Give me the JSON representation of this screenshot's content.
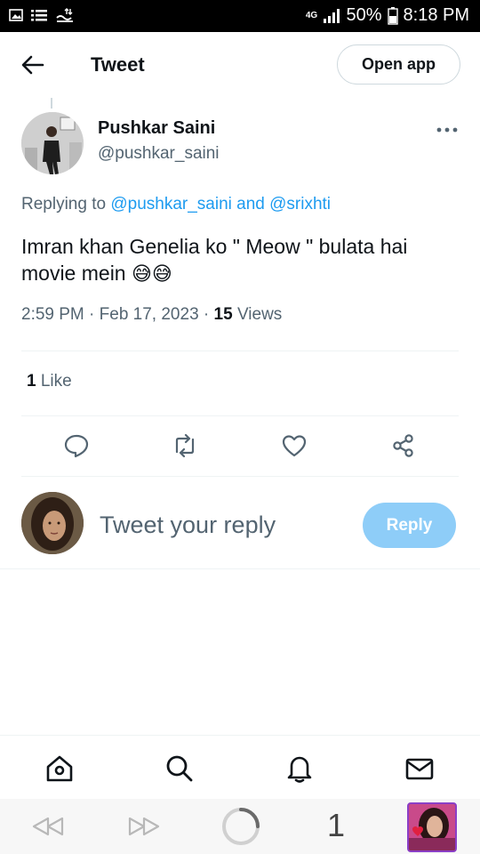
{
  "status_bar": {
    "network": "4G",
    "battery": "50%",
    "time": "8:18 PM"
  },
  "header": {
    "title": "Tweet",
    "open_app_label": "Open app"
  },
  "tweet": {
    "author_name": "Pushkar Saini",
    "author_handle": "@pushkar_saini",
    "replying_prefix": "Replying to",
    "replying_mentions": "@pushkar_saini and @srixhti",
    "text": "Imran khan Genelia ko \" Meow \" bulata hai movie mein",
    "emojis": "😅😅",
    "time": "2:59 PM",
    "separator": " · ",
    "date": "Feb 17, 2023",
    "views_count": "15",
    "views_label": "Views",
    "likes_count": "1",
    "likes_label": "Like"
  },
  "reply": {
    "placeholder": "Tweet your reply",
    "button_label": "Reply"
  },
  "browser": {
    "tab_count": "1"
  },
  "colors": {
    "accent": "#1d9bf0",
    "reply_button": "#8ecdf8",
    "secondary_text": "#536471",
    "primary_text": "#0f1419"
  },
  "icons": {
    "back": "arrow-left-icon",
    "more": "more-horizontal-icon",
    "reply": "comment-icon",
    "retweet": "retweet-icon",
    "like": "heart-icon",
    "share": "share-icon",
    "home": "home-icon",
    "search": "search-icon",
    "notifications": "bell-icon",
    "messages": "mail-icon"
  }
}
